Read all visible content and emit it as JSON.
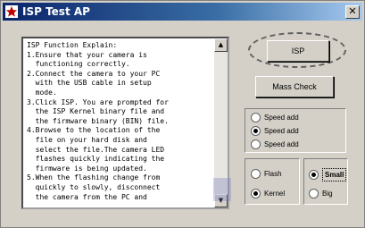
{
  "window": {
    "title": "ISP Test AP",
    "close_glyph": "✕",
    "icon": "app-star-icon"
  },
  "instructions": {
    "lines": [
      "ISP Function Explain:",
      "1.Ensure that your camera is",
      "  functioning correctly.",
      "2.Connect the camera to your PC",
      "  with the USB cable in setup",
      "  mode.",
      "3.Click ISP. You are prompted for",
      "  the ISP Kernel binary file and",
      "  the firmware binary (BIN) file.",
      "4.Browse to the location of the",
      "  file on your hard disk and",
      "  select the file.The camera LED",
      "  flashes quickly indicating the",
      "  firmware is being updated.",
      "5.When the flashing change from",
      "  quickly to slowly, disconnect",
      "  the camera from the PC and"
    ]
  },
  "buttons": {
    "isp": "ISP",
    "mass_check": "Mass Check"
  },
  "speed_options": [
    {
      "label": "Speed add",
      "checked": false
    },
    {
      "label": "Speed add",
      "checked": true
    },
    {
      "label": "Speed add",
      "checked": false
    }
  ],
  "mode_options": [
    {
      "label": "Flash",
      "checked": false
    },
    {
      "label": "Kernel",
      "checked": true
    }
  ],
  "type_options": [
    {
      "label": "Small",
      "checked": true
    },
    {
      "label": "Big",
      "checked": false
    }
  ],
  "colors": {
    "title_start": "#0a246a",
    "title_end": "#a6caf0",
    "face": "#d4d0c8"
  }
}
